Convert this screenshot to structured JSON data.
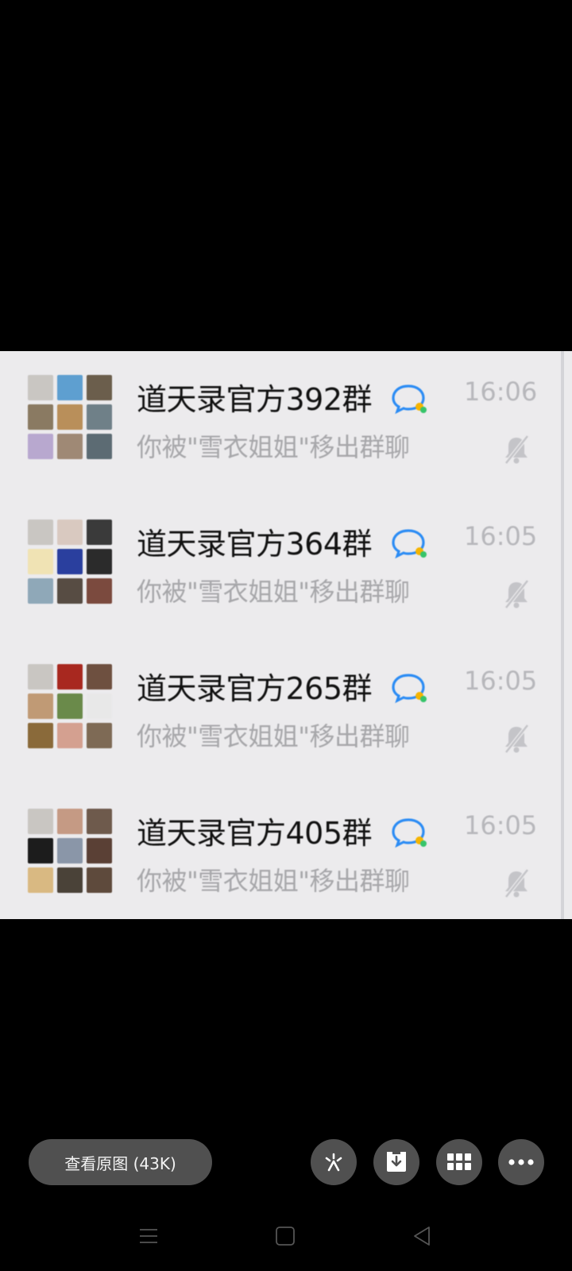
{
  "chats": [
    {
      "name": "道天录官方392群",
      "preview": "你被\"雪衣姐姐\"移出群聊",
      "time": "16:06",
      "avatar_colors": [
        "#c9c6c2",
        "#5e9fd0",
        "#6b5e4c",
        "#8a7a62",
        "#b98f5a",
        "#6f8088",
        "#b8a8cf",
        "#9f8975",
        "#5c6b73"
      ]
    },
    {
      "name": "道天录官方364群",
      "preview": "你被\"雪衣姐姐\"移出群聊",
      "time": "16:05",
      "avatar_colors": [
        "#c9c6c2",
        "#d9c9c0",
        "#3a3a3a",
        "#f0e3b4",
        "#2a3f9e",
        "#2b2b2b",
        "#8fa8b8",
        "#574c43",
        "#7b4a3e"
      ]
    },
    {
      "name": "道天录官方265群",
      "preview": "你被\"雪衣姐姐\"移出群聊",
      "time": "16:05",
      "avatar_colors": [
        "#c9c6c2",
        "#a8281f",
        "#6e5040",
        "#c09a75",
        "#6a8a4a",
        "#e8e8e8",
        "#8a6a3a",
        "#d4a090",
        "#7e6a55"
      ]
    },
    {
      "name": "道天录官方405群",
      "preview": "你被\"雪衣姐姐\"移出群聊",
      "time": "16:05",
      "avatar_colors": [
        "#c9c6c2",
        "#c59a84",
        "#6e5a4c",
        "#1c1c1c",
        "#8a96a8",
        "#5a4035",
        "#d9b982",
        "#4a4238",
        "#5e4a3c"
      ]
    }
  ],
  "toolbar": {
    "view_original_label": "查看原图 (43K)",
    "icons": [
      "sparkle-icon",
      "download-icon",
      "grid-icon",
      "more-icon"
    ]
  },
  "navbar": {
    "icons": [
      "menu-icon",
      "home-icon",
      "back-icon"
    ]
  },
  "colors": {
    "chat_icon_blue": "#2c8cf4",
    "chat_icon_yellow": "#f5b400",
    "chat_icon_green": "#36c46a",
    "button_bg": "#505050"
  }
}
